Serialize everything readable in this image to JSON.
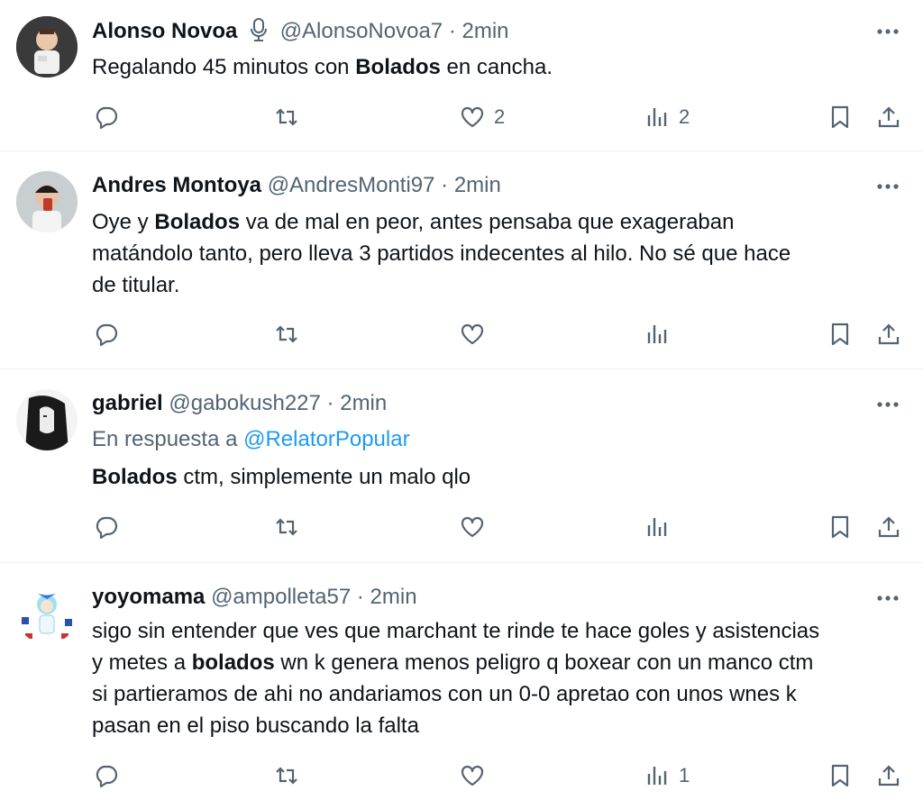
{
  "tweets": [
    {
      "name": "Alonso Novoa",
      "handle": "@AlonsoNovoa7",
      "dot": "·",
      "time": "2min",
      "badge": "microphone-icon",
      "text": [
        {
          "t": "Regalando 45 minutos con "
        },
        {
          "t": "Bolados",
          "bold": true
        },
        {
          "t": " en cancha."
        }
      ],
      "likes": "2",
      "views": "2"
    },
    {
      "name": "Andres Montoya",
      "handle": "@AndresMonti97",
      "dot": "·",
      "time": "2min",
      "text_lines": [
        "Oye y Bolados va de mal en peor, antes pensaba que exageraban",
        "matándolo tanto, pero lleva 3 partidos indecentes al hilo. No sé que hace",
        "de titular."
      ],
      "likes": "",
      "views": ""
    },
    {
      "name": "gabriel",
      "handle": "@gabokush227",
      "dot": "·",
      "time": "2min",
      "replying_prefix": "En respuesta a ",
      "replying_to": "@RelatorPopular",
      "text_bold": "Bolados",
      "text_rest": " ctm, simplemente un malo qlo",
      "likes": "",
      "views": ""
    },
    {
      "name": "yoyomama",
      "handle": "@ampolleta57",
      "dot": "·",
      "time": "2min",
      "text_lines": [
        "sigo sin entender que ves que marchant te rinde te hace goles y asistencias",
        "y metes a bolados wn k genera menos peligro q boxear con un manco ctm",
        "si partieramos de ahi no andariamos con un 0-0 apretao con unos wnes k",
        "pasan en el piso buscando la falta"
      ],
      "likes": "",
      "views": "1"
    }
  ],
  "icons": {
    "reply": "reply-icon",
    "retweet": "retweet-icon",
    "like": "heart-icon",
    "views": "views-icon",
    "bookmark": "bookmark-icon",
    "share": "share-icon",
    "more": "more-icon"
  }
}
